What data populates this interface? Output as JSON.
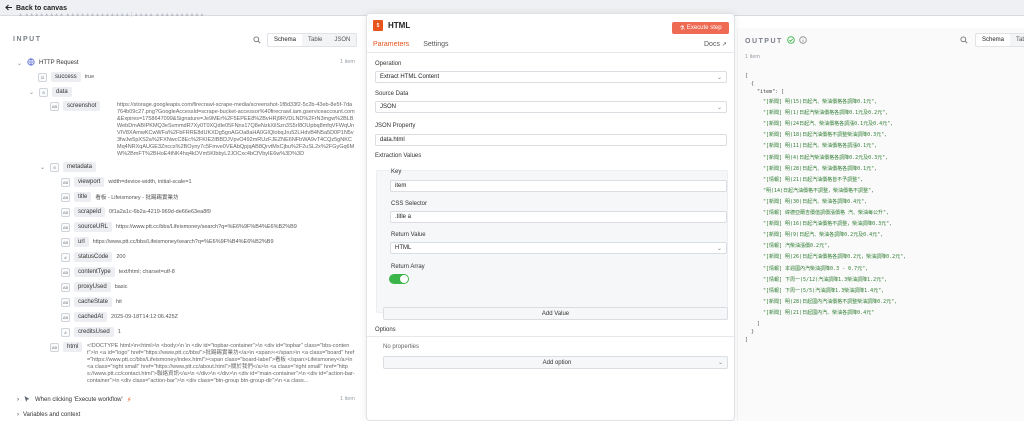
{
  "topbar": {
    "back_label": "Back to canvas",
    "faint_crumb": "▲ ▲▲▲▲▲▲▲▲ ▲▲▲▲▲▲▲▲▲▲▲▲▲ | ▲▲▲▲ ▲▲▲▲▲▲▲▲▲▲"
  },
  "input_panel": {
    "heading": "INPUT",
    "tabs": [
      "Schema",
      "Table",
      "JSON"
    ],
    "active_tab": "Schema",
    "node_name": "HTTP Request",
    "item_count": "1 item",
    "fields": {
      "success": {
        "key": "success",
        "value": "true"
      },
      "data": {
        "key": "data"
      },
      "screenshot": {
        "key": "screenshot",
        "value": "https://storage.googleapis.com/firecrawl-scrape-media/screenshot-1f8d33f2-5c2b-43eb-8e5f-7da764b09c27.png?GoogleAccessId=scrape-bucket-accessor%40firecrawl.iam.gserviceaccount.com&Expires=1758647099&Signature=Je9MEr%2F5EPEE8%2BvHRj9RVDLND%2FrN3mgw%2BLBWebDmABIPKMQ3eSvmmdR7Xy0T0XQdIe05FNns17Q8eNzkXilSzn3S5rI8OUpbq8mfqVFWqUnVIV8XAmwKCwWFa%2FbFRRE8dUKXDg5goAGOa8aHA0GIQlobqJru52LHdvB4N5a5D0P1N5v3fwJw5pXS2a%2FXNwcC8Ec%2FKIE2IBBDJVpvO492mRUzFJEZNE6NFbWA9vT4CQz5gNKCMq4NRXqAUGE3Znccs%2BOyny7c5Fmve0VEAbQpjqAB8QrvtMxCjbu%2F2uSL2x%2FGyGq6MW%2BmFT%2BHoE4tNK4hq4kOVm5KIbbyL2JOCxc4bCfVbyIE6w%3D%3D"
      },
      "metadata": {
        "key": "metadata"
      },
      "viewport": {
        "key": "viewport",
        "value": "width=device-width, initial-scale=1"
      },
      "title": {
        "key": "title",
        "value": "看板 - Lifeismoney - 批踢踢實業坊"
      },
      "scrapeId": {
        "key": "scrapeId",
        "value": "0f1a2a1c-6b2a-4219-969d-de66e63ea8f9"
      },
      "sourceURL": {
        "key": "sourceURL",
        "value": "https://www.ptt.cc/bbs/Lifeismoney/search?q=%E6%9F%B4%E6%B2%B9"
      },
      "url": {
        "key": "url",
        "value": "https://www.ptt.cc/bbs/Lifeismoney/search?q=%E6%9F%B4%E6%B2%B9"
      },
      "statusCode": {
        "key": "statusCode",
        "value": "200"
      },
      "contentType": {
        "key": "contentType",
        "value": "text/html; charset=utf-8"
      },
      "proxyUsed": {
        "key": "proxyUsed",
        "value": "basic"
      },
      "cacheState": {
        "key": "cacheState",
        "value": "hit"
      },
      "cachedAt": {
        "key": "cachedAt",
        "value": "2025-09-18T14:12:06.425Z"
      },
      "creditsUsed": {
        "key": "creditsUsed",
        "value": "1"
      },
      "html": {
        "key": "html",
        "value": "<!DOCTYPE html>\\n<html>\\n  <body>\\n  \\n  <div id=\"topbar-container\">\\n    <div id=\"topbar\" class=\"bbs-content\">\\n      <a id=\"logo\" href=\"https://www.ptt.cc/bbs/\">批踢踢實業坊</a>\\n      <span>›</span>\\n      <a class=\"board\" href=\"https://www.ptt.cc/bbs/Lifeismoney/index.html\"><span class=\"board-label\">看板 </span>Lifeismoney</a>\\n      <a class=\"right small\" href=\"https://www.ptt.cc/about.html\">關於我們</a>\\n      <a class=\"right small\" href=\"https://www.ptt.cc/contact.html\">聯絡資訊</a>\\n    </div>\\n  </div>\\n  <div id=\"main-container\">\\n    <div id=\"action-bar-container\">\\n      <div class=\"action-bar\">\\n        <div class=\"btn-group btn-group-dir\">\\n  <a class..."
      }
    },
    "bottom": {
      "when_clicking": "When clicking 'Execute workflow'",
      "when_count": "1 item",
      "vars": "Variables and context"
    }
  },
  "modal": {
    "title": "HTML",
    "execute_label": "Execute step",
    "tabs": [
      "Parameters",
      "Settings"
    ],
    "docs_label": "Docs",
    "operation_label": "Operation",
    "operation_value": "Extract HTML Content",
    "source_label": "Source Data",
    "source_value": "JSON",
    "json_prop_label": "JSON Property",
    "json_prop_value": "data.html",
    "extraction_label": "Extraction Values",
    "key_label": "Key",
    "key_value": "item",
    "css_label": "CSS Selector",
    "css_value": ".title a",
    "return_label": "Return Value",
    "return_value": "HTML",
    "return_array_label": "Return Array",
    "return_array": true,
    "add_value_label": "Add Value",
    "options_label": "Options",
    "no_props": "No properties",
    "add_option_label": "Add option"
  },
  "output_panel": {
    "heading": "OUTPUT",
    "item_count": "1 item",
    "tabs": [
      "Schema",
      "Table"
    ],
    "active_tab": "Schema",
    "json_key": "item",
    "json_items": [
      "[新聞] 明(15)日起汽、柴油價格各調降0.1元",
      "[新聞] 明(1)日起汽柴油價格各調降0.1元及0.2元",
      "[新聞] 明(24日起汽、柴油價格各調漲0.1元及0.4元",
      "[新聞] 明(18)日起汽油價格不調整柴油調降0.3元",
      "[新聞] 明(11)日起汽、柴油價格各調漲0.1元",
      "[新聞] 明(4)日起汽柴油價格各調降0.2元及0.3元",
      "[新聞] 明(28)日起汽、柴油價格各調降0.1元",
      "[情報] 明(21)日起汽油價格皆不予調整",
      "明(14)日起汽油價格不調整，柴油價格不調整",
      "[新聞] 明(30)日起汽、柴油各調降0.4元",
      "[情報] 緯德亞爾吉價值調價漲價格 汽、柴油每公升",
      "[新聞] 明(16)日起汽油價格不調整，柴油調降0.3元",
      "[新聞] 明(9)日起汽、柴油各調降0.2元及0.4元",
      "[情報] 汽柴油漲價0.2元",
      "[新聞] 明(26)日起汽油價格各調降0.2元，柴油調降0.2元",
      "[情報] 本週國內汽柴油調降0.3 - 0.7元",
      "[情報] 下周一(5/12)汽油調降1.3柴油調降1.2元",
      "[情報] 下周一(5/5)汽油調降1.3柴油調降1.4元",
      "[新聞] 明(28)日起國內汽油價格不調整柴油調降0.2元",
      "[新聞] 明(21)日起國內汽、柴油各調降0.4元"
    ]
  }
}
